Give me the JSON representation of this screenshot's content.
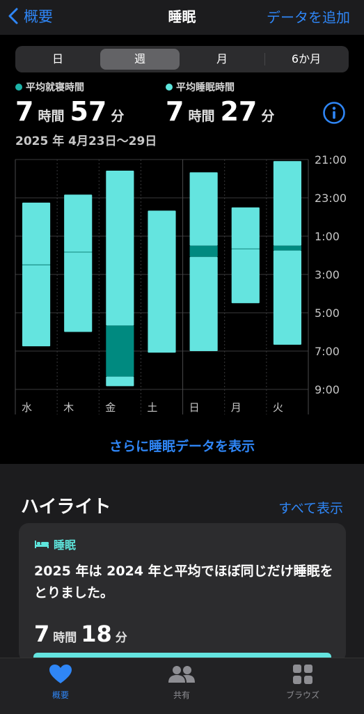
{
  "nav": {
    "back_label": "概要",
    "title": "睡眠",
    "add_label": "データを追加"
  },
  "segments": [
    "日",
    "週",
    "月",
    "6か月"
  ],
  "selected_segment": "週",
  "stats": {
    "bedtime": {
      "label": "平均就寝時間",
      "hours": "7",
      "hours_unit": "時間",
      "minutes": "57",
      "minutes_unit": "分",
      "dot_color": "#1db3a8"
    },
    "sleep": {
      "label": "平均睡眠時間",
      "hours": "7",
      "hours_unit": "時間",
      "minutes": "27",
      "minutes_unit": "分",
      "dot_color": "#5ee6dd"
    }
  },
  "date_range": "2025 年 4月23日～29日",
  "chart_data": {
    "type": "bar",
    "categories": [
      "水",
      "木",
      "金",
      "土",
      "日",
      "月",
      "火"
    ],
    "y_ticks": [
      "21:00",
      "23:00",
      "1:00",
      "3:00",
      "5:00",
      "7:00",
      "9:00"
    ],
    "ylim_hours_after_21": [
      0,
      12
    ],
    "colors": {
      "asleep": "#64e4df",
      "awake": "#008a80"
    },
    "series": [
      {
        "day": "水",
        "start": "23:15",
        "end": "6:45",
        "segments": [
          {
            "state": "asleep",
            "start": "23:15",
            "end": "2:30"
          },
          {
            "state": "asleep",
            "start": "2:30",
            "end": "6:45"
          }
        ]
      },
      {
        "day": "木",
        "start": "22:50",
        "end": "6:00",
        "segments": [
          {
            "state": "asleep",
            "start": "22:50",
            "end": "1:50"
          },
          {
            "state": "asleep",
            "start": "1:50",
            "end": "6:00"
          }
        ]
      },
      {
        "day": "金",
        "start": "21:35",
        "end": "8:50",
        "segments": [
          {
            "state": "asleep",
            "start": "21:35",
            "end": "5:40"
          },
          {
            "state": "awake",
            "start": "5:40",
            "end": "8:20"
          },
          {
            "state": "asleep",
            "start": "8:20",
            "end": "8:50"
          }
        ]
      },
      {
        "day": "土",
        "start": "23:40",
        "end": "7:05",
        "segments": [
          {
            "state": "asleep",
            "start": "23:40",
            "end": "7:05"
          }
        ]
      },
      {
        "day": "日",
        "start": "21:40",
        "end": "7:00",
        "segments": [
          {
            "state": "asleep",
            "start": "21:40",
            "end": "1:30"
          },
          {
            "state": "awake",
            "start": "1:30",
            "end": "2:05"
          },
          {
            "state": "asleep",
            "start": "2:05",
            "end": "7:00"
          }
        ]
      },
      {
        "day": "月",
        "start": "23:30",
        "end": "4:30",
        "segments": [
          {
            "state": "asleep",
            "start": "23:30",
            "end": "1:40"
          },
          {
            "state": "asleep",
            "start": "1:40",
            "end": "4:30"
          }
        ]
      },
      {
        "day": "火",
        "start": "21:05",
        "end": "6:40",
        "segments": [
          {
            "state": "asleep",
            "start": "21:05",
            "end": "1:30"
          },
          {
            "state": "awake",
            "start": "1:30",
            "end": "1:45"
          },
          {
            "state": "asleep",
            "start": "1:45",
            "end": "6:40"
          }
        ]
      }
    ]
  },
  "more_link": "さらに睡眠データを表示",
  "highlights": {
    "title": "ハイライト",
    "see_all": "すべて表示",
    "card": {
      "category": "睡眠",
      "text": "2025 年は 2024 年と平均でほぼ同じだけ睡眠をとりました。",
      "hours": "7",
      "hours_unit": "時間",
      "minutes": "18",
      "minutes_unit": "分"
    }
  },
  "tabbar": [
    {
      "label": "概要",
      "icon": "heart-icon",
      "active": true
    },
    {
      "label": "共有",
      "icon": "people-icon",
      "active": false
    },
    {
      "label": "ブラウズ",
      "icon": "grid-icon",
      "active": false
    }
  ]
}
